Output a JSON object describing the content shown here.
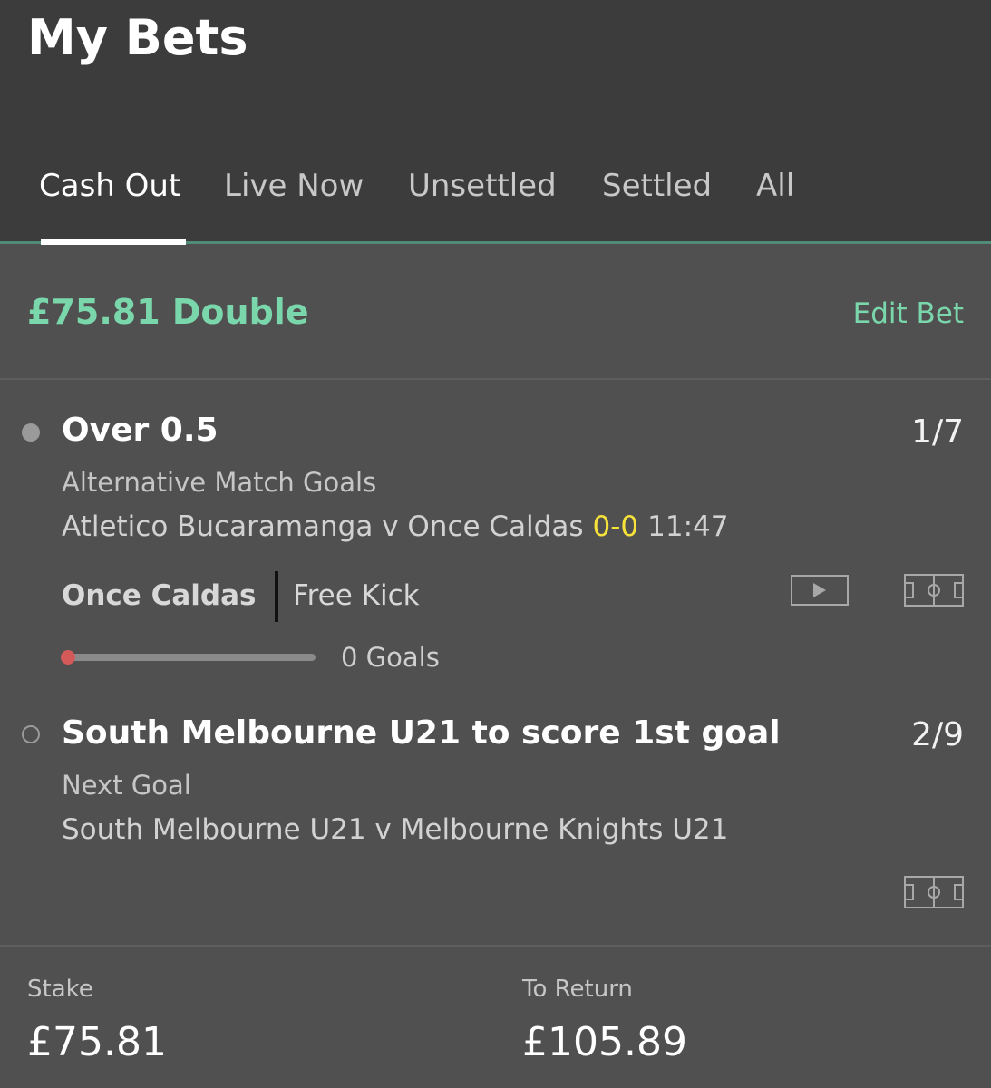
{
  "header": {
    "title": "My Bets",
    "tabs": [
      {
        "label": "Cash Out",
        "active": true
      },
      {
        "label": "Live Now",
        "active": false
      },
      {
        "label": "Unsettled",
        "active": false
      },
      {
        "label": "Settled",
        "active": false
      },
      {
        "label": "All",
        "active": false
      }
    ]
  },
  "bet": {
    "title": "£75.81 Double",
    "edit_label": "Edit Bet",
    "selections": [
      {
        "status": "filled-dot-icon",
        "name": "Over 0.5",
        "odds": "1/7",
        "market": "Alternative Match Goals",
        "event": "Atletico Bucaramanga v Once Caldas",
        "score": "0-0",
        "clock": "11:47",
        "live_team": "Once Caldas",
        "live_event": "Free Kick",
        "progress_label": "0 Goals",
        "progress_fraction": 0,
        "icons": [
          "video-icon",
          "pitch-icon"
        ]
      },
      {
        "status": "hollow-dot-icon",
        "name": "South Melbourne U21 to score 1st goal",
        "odds": "2/9",
        "market": "Next Goal",
        "event": "South Melbourne U21 v Melbourne Knights U21",
        "icons": [
          "pitch-icon"
        ]
      }
    ]
  },
  "footer": {
    "stake_label": "Stake",
    "stake_value": "£75.81",
    "return_label": "To Return",
    "return_value": "£105.89"
  },
  "colors": {
    "accent": "#7ad6ab",
    "score": "#f7e23a",
    "header_bg": "#3c3c3c",
    "body_bg": "#505050",
    "progress_knob": "#d45a5a"
  }
}
